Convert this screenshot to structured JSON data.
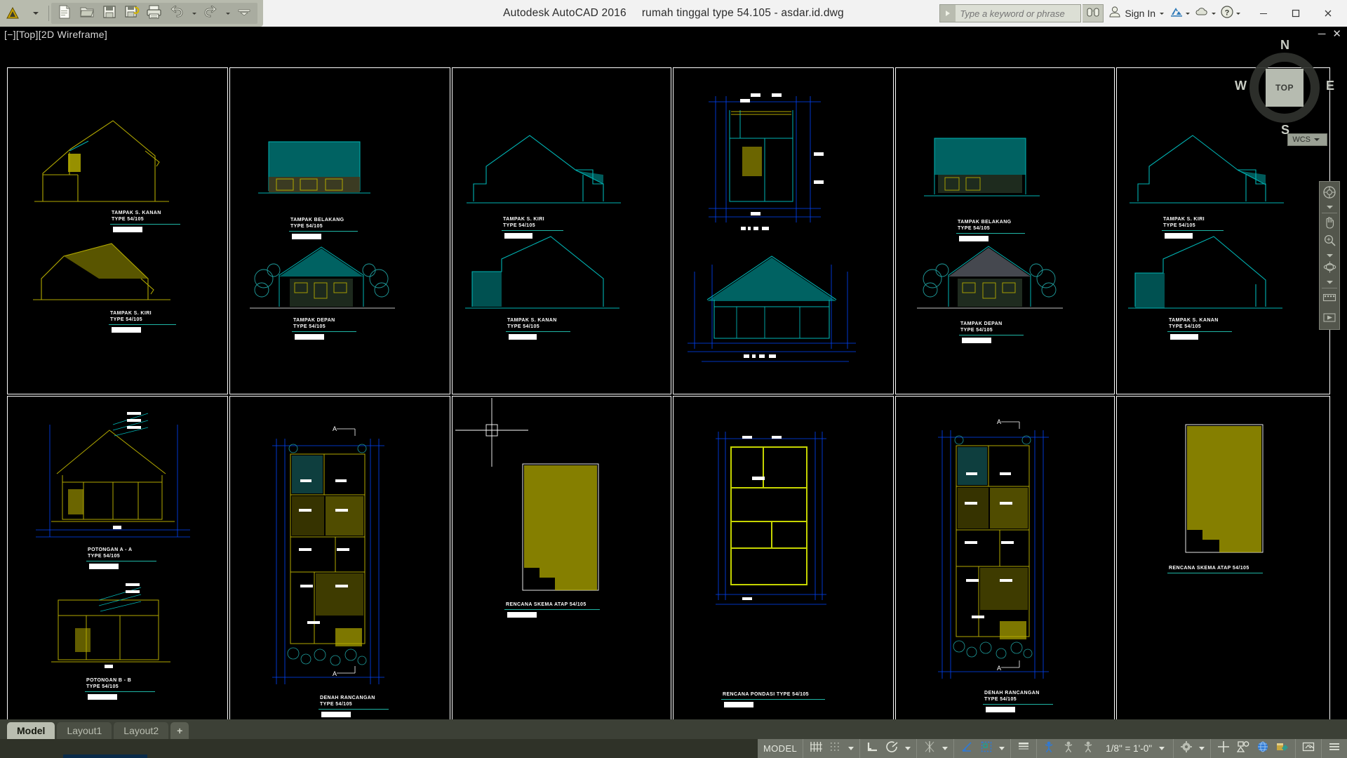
{
  "app": {
    "product": "Autodesk AutoCAD 2016",
    "document": "rumah tinggal type 54.105 - asdar.id.dwg",
    "viewport_label": "[−][Top][2D Wireframe]"
  },
  "quick_access": {
    "app_menu": "application-menu",
    "buttons": [
      {
        "name": "new-drawing",
        "icon": "new-file-icon",
        "label": "New"
      },
      {
        "name": "open-drawing",
        "icon": "open-folder-icon",
        "label": "Open"
      },
      {
        "name": "save-drawing",
        "icon": "save-disk-icon",
        "label": "Save"
      },
      {
        "name": "save-as-drawing",
        "icon": "save-as-icon",
        "label": "Save As"
      },
      {
        "name": "plot",
        "icon": "printer-icon",
        "label": "Plot"
      },
      {
        "name": "undo",
        "icon": "undo-arrow-icon",
        "label": "Undo"
      },
      {
        "name": "redo",
        "icon": "redo-arrow-icon",
        "label": "Redo"
      },
      {
        "name": "customize-qat",
        "icon": "chevron-down-icon",
        "label": "Customize"
      }
    ]
  },
  "search": {
    "placeholder": "Type a keyword or phrase",
    "search_icon": "binoculars-icon"
  },
  "account": {
    "sign_in_label": "Sign In",
    "avatar_icon": "user-icon",
    "dropdown_icon": "chevron-down-icon",
    "exchange_icon": "autodesk-exchange-icon",
    "help_icon": "question-mark-icon",
    "cloud_icon": "cloud-icon"
  },
  "window_controls": {
    "minimize": "─",
    "maximize": "□",
    "close": "✕"
  },
  "viewport_controls": {
    "minimize": "─",
    "close": "✕"
  },
  "viewcube": {
    "top_face": "TOP",
    "north": "N",
    "south": "S",
    "west": "W",
    "east": "E",
    "ucs_label": "WCS"
  },
  "navbar": {
    "items": [
      {
        "name": "full-navigation-wheel",
        "icon": "steering-wheel-icon"
      },
      {
        "name": "pan-tool",
        "icon": "hand-icon"
      },
      {
        "name": "zoom-tool",
        "icon": "magnifier-zoom-icon"
      },
      {
        "name": "orbit-tool",
        "icon": "orbit-icon"
      },
      {
        "name": "showmotion",
        "icon": "filmstrip-icon"
      }
    ]
  },
  "layout_tabs": {
    "tabs": [
      {
        "label": "Model",
        "active": true
      },
      {
        "label": "Layout1",
        "active": false
      },
      {
        "label": "Layout2",
        "active": false
      }
    ],
    "add_label": "+"
  },
  "status_bar": {
    "space_label": "MODEL",
    "scale_label": "1/8\" = 1'-0\"",
    "buttons": [
      {
        "name": "display-drawing-grid",
        "icon": "grid-lines-icon"
      },
      {
        "name": "snap-mode",
        "icon": "snap-dots-icon"
      },
      {
        "name": "snap-dropdown",
        "icon": "chevron-down-icon"
      },
      {
        "name": "ortho-mode",
        "icon": "ortho-corner-icon"
      },
      {
        "name": "polar-tracking",
        "icon": "polar-angle-icon"
      },
      {
        "name": "polar-dropdown",
        "icon": "chevron-down-icon"
      },
      {
        "name": "object-snap-tracking",
        "icon": "osnap-tracking-icon"
      },
      {
        "name": "osnap-dropdown",
        "icon": "chevron-down-icon"
      },
      {
        "name": "object-snap",
        "icon": "osnap-square-icon"
      },
      {
        "name": "lineweight",
        "icon": "lineweight-bars-icon"
      },
      {
        "name": "transparency",
        "icon": "transparency-icon"
      },
      {
        "name": "selection-cycling",
        "icon": "selection-cycling-icon"
      },
      {
        "name": "3d-object-snap",
        "icon": "3d-osnap-icon"
      },
      {
        "name": "dynamic-ucs",
        "icon": "dynamic-ucs-icon"
      },
      {
        "name": "annotation-visibility",
        "icon": "annotation-icon"
      },
      {
        "name": "autoscale",
        "icon": "autoscale-icon"
      },
      {
        "name": "workspace-switching",
        "icon": "gear-icon"
      },
      {
        "name": "workspace-dropdown",
        "icon": "chevron-down-icon"
      },
      {
        "name": "hardware-acceleration",
        "icon": "crosshair-icon"
      },
      {
        "name": "isolate-objects",
        "icon": "isolate-shapes-icon"
      },
      {
        "name": "graphics-performance",
        "icon": "globe-icon"
      },
      {
        "name": "clean-screen",
        "icon": "clean-screen-icon"
      },
      {
        "name": "lock-ui",
        "icon": "lock-ui-icon"
      },
      {
        "name": "customization",
        "icon": "hamburger-icon"
      }
    ]
  },
  "sheets": [
    {
      "name": "sheet-1",
      "drawings": [
        {
          "title": "TAMPAK S. KANAN",
          "subtitle": "TYPE 54/105"
        },
        {
          "title": "TAMPAK S. KIRI",
          "subtitle": "TYPE 54/105"
        }
      ]
    },
    {
      "name": "sheet-2",
      "drawings": [
        {
          "title": "TAMPAK BELAKANG",
          "subtitle": "TYPE 54/105"
        },
        {
          "title": "TAMPAK DEPAN",
          "subtitle": "TYPE 54/105"
        }
      ]
    },
    {
      "name": "sheet-3",
      "drawings": [
        {
          "title": "TAMPAK S. KIRI",
          "subtitle": "TYPE 54/105"
        },
        {
          "title": "TAMPAK S. KANAN",
          "subtitle": "TYPE 54/105"
        }
      ]
    },
    {
      "name": "sheet-4",
      "drawings": [
        {
          "title": "",
          "subtitle": ""
        },
        {
          "title": "",
          "subtitle": ""
        }
      ]
    },
    {
      "name": "sheet-5",
      "drawings": [
        {
          "title": "TAMPAK BELAKANG",
          "subtitle": "TYPE 54/105"
        },
        {
          "title": "TAMPAK DEPAN",
          "subtitle": "TYPE 54/105"
        }
      ]
    },
    {
      "name": "sheet-6",
      "drawings": [
        {
          "title": "TAMPAK S. KIRI",
          "subtitle": "TYPE 54/105"
        },
        {
          "title": "TAMPAK S. KANAN",
          "subtitle": "TYPE 54/105"
        }
      ]
    },
    {
      "name": "sheet-7",
      "drawings": [
        {
          "title": "POTONGAN A - A",
          "subtitle": "TYPE 54/105"
        },
        {
          "title": "POTONGAN B - B",
          "subtitle": "TYPE 54/105"
        }
      ]
    },
    {
      "name": "sheet-8",
      "drawings": [
        {
          "title": "DENAH RANCANGAN",
          "subtitle": "TYPE 54/105"
        }
      ]
    },
    {
      "name": "sheet-9",
      "drawings": [
        {
          "title": "RENCANA SKEMA ATAP 54/105",
          "subtitle": ""
        }
      ]
    },
    {
      "name": "sheet-10",
      "drawings": [
        {
          "title": "RENCANA PONDASI TYPE 54/105",
          "subtitle": ""
        }
      ]
    },
    {
      "name": "sheet-11",
      "drawings": [
        {
          "title": "DENAH RANCANGAN",
          "subtitle": "TYPE 54/105"
        }
      ]
    },
    {
      "name": "sheet-12",
      "drawings": [
        {
          "title": "RENCANA SKEMA ATAP 54/105",
          "subtitle": ""
        }
      ]
    }
  ],
  "section_marks": {
    "a_top": "A",
    "a_bottom": "A"
  },
  "colors": {
    "background": "#000000",
    "cyan": "#00b3b3",
    "yellow": "#b2a900",
    "blue": "#0000ff",
    "white": "#ffffff"
  }
}
